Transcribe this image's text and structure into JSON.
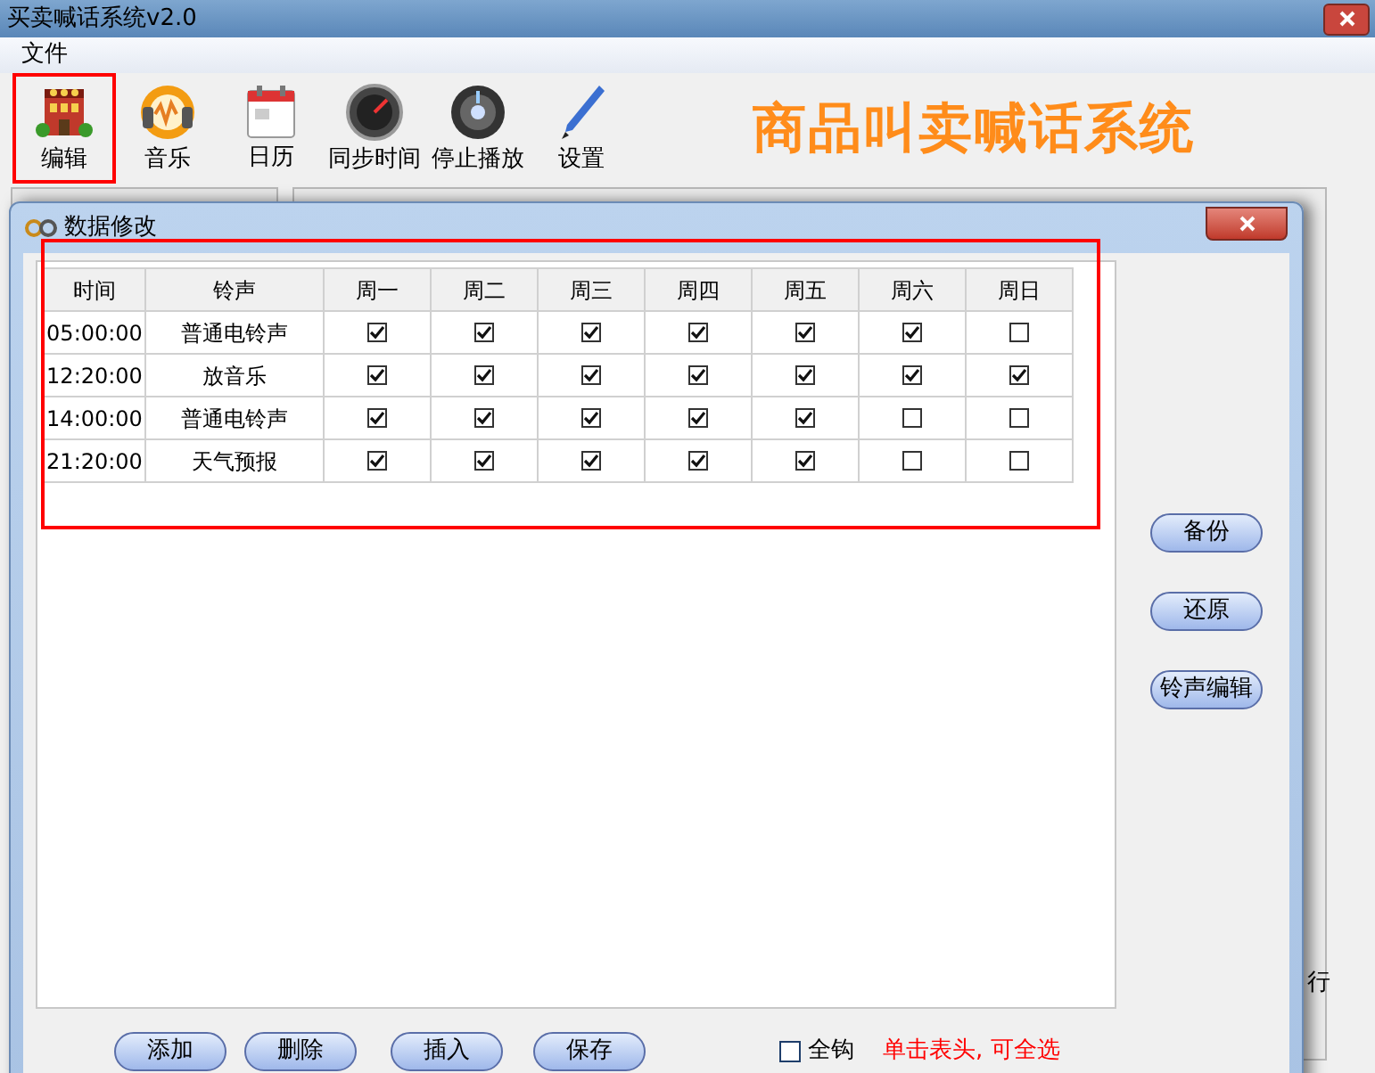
{
  "window": {
    "title": "买卖喊话系统v2.0"
  },
  "menu": [
    "文件"
  ],
  "toolbar": [
    {
      "label": "编辑",
      "highlighted": true
    },
    {
      "label": "音乐",
      "highlighted": false
    },
    {
      "label": "日历",
      "highlighted": false
    },
    {
      "label": "同步时间",
      "highlighted": false
    },
    {
      "label": "停止播放",
      "highlighted": false
    },
    {
      "label": "设置",
      "highlighted": false
    }
  ],
  "banner": "商品叫卖喊话系统",
  "background": {
    "side_text": "行"
  },
  "dialog": {
    "title": "数据修改",
    "table": {
      "highlighted": true,
      "columns": [
        "时间",
        "铃声",
        "周一",
        "周二",
        "周三",
        "周四",
        "周五",
        "周六",
        "周日"
      ],
      "rows": [
        {
          "time": "05:00:00",
          "ringtone": "普通电铃声",
          "days": [
            true,
            true,
            true,
            true,
            true,
            true,
            false
          ]
        },
        {
          "time": "12:20:00",
          "ringtone": "放音乐",
          "days": [
            true,
            true,
            true,
            true,
            true,
            true,
            true
          ]
        },
        {
          "time": "14:00:00",
          "ringtone": "普通电铃声",
          "days": [
            true,
            true,
            true,
            true,
            true,
            false,
            false
          ]
        },
        {
          "time": "21:20:00",
          "ringtone": "天气预报",
          "days": [
            true,
            true,
            true,
            true,
            true,
            false,
            false
          ]
        }
      ]
    },
    "side_buttons": [
      "备份",
      "还原",
      "铃声编辑"
    ],
    "bottom_buttons": [
      "添加",
      "删除",
      "插入",
      "保存"
    ],
    "select_all": {
      "label": "全钩",
      "checked": false
    },
    "hint": "单击表头, 可全选"
  }
}
